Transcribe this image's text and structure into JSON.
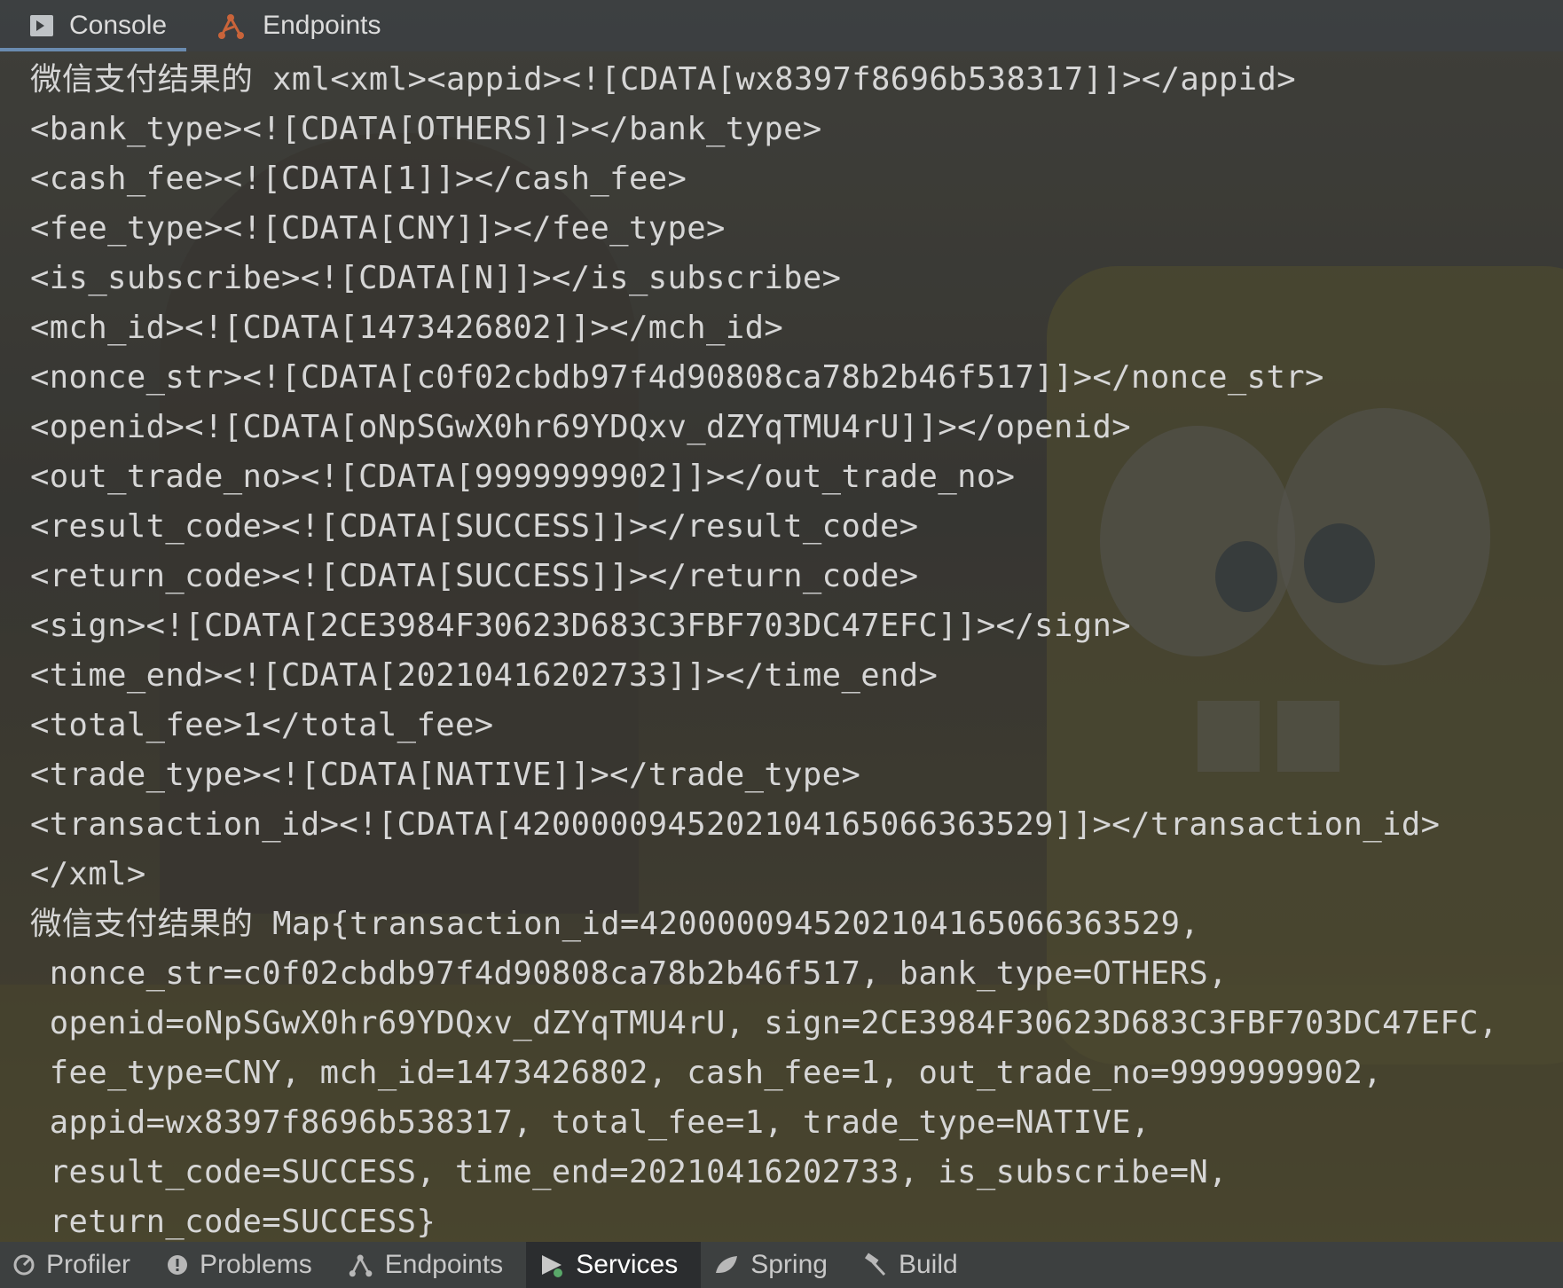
{
  "top_tabs": [
    {
      "label": "Console",
      "icon": "console-icon",
      "active": true
    },
    {
      "label": "Endpoints",
      "icon": "endpoints-icon",
      "active": false
    }
  ],
  "console_lines": [
    "微信支付结果的 xml<xml><appid><![CDATA[wx8397f8696b538317]]></appid>",
    "<bank_type><![CDATA[OTHERS]]></bank_type>",
    "<cash_fee><![CDATA[1]]></cash_fee>",
    "<fee_type><![CDATA[CNY]]></fee_type>",
    "<is_subscribe><![CDATA[N]]></is_subscribe>",
    "<mch_id><![CDATA[1473426802]]></mch_id>",
    "<nonce_str><![CDATA[c0f02cbdb97f4d90808ca78b2b46f517]]></nonce_str>",
    "<openid><![CDATA[oNpSGwX0hr69YDQxv_dZYqTMU4rU]]></openid>",
    "<out_trade_no><![CDATA[9999999902]]></out_trade_no>",
    "<result_code><![CDATA[SUCCESS]]></result_code>",
    "<return_code><![CDATA[SUCCESS]]></return_code>",
    "<sign><![CDATA[2CE3984F30623D683C3FBF703DC47EFC]]></sign>",
    "<time_end><![CDATA[20210416202733]]></time_end>",
    "<total_fee>1</total_fee>",
    "<trade_type><![CDATA[NATIVE]]></trade_type>",
    "<transaction_id><![CDATA[4200000945202104165066363529]]></transaction_id>",
    "</xml>",
    "微信支付结果的 Map{transaction_id=4200000945202104165066363529,",
    " nonce_str=c0f02cbdb97f4d90808ca78b2b46f517, bank_type=OTHERS,",
    " openid=oNpSGwX0hr69YDQxv_dZYqTMU4rU, sign=2CE3984F30623D683C3FBF703DC47EFC,",
    " fee_type=CNY, mch_id=1473426802, cash_fee=1, out_trade_no=9999999902,",
    " appid=wx8397f8696b538317, total_fee=1, trade_type=NATIVE,",
    " result_code=SUCCESS, time_end=20210416202733, is_subscribe=N,",
    " return_code=SUCCESS}"
  ],
  "bottom_tabs": [
    {
      "label": "Profiler",
      "icon": "profiler-icon",
      "active": false
    },
    {
      "label": "Problems",
      "icon": "problems-icon",
      "active": false
    },
    {
      "label": "Endpoints",
      "icon": "endpoints-icon",
      "active": false
    },
    {
      "label": "Services",
      "icon": "services-icon",
      "active": true
    },
    {
      "label": "Spring",
      "icon": "spring-icon",
      "active": false
    },
    {
      "label": "Build",
      "icon": "build-icon",
      "active": false
    }
  ],
  "colors": {
    "console_text": "#d6d6d6",
    "toolbar_bg": "#3c3f41",
    "active_tab_underline": "#6a8bb0",
    "services_status_dot": "#59a869",
    "endpoints_icon": "#c9643a"
  }
}
